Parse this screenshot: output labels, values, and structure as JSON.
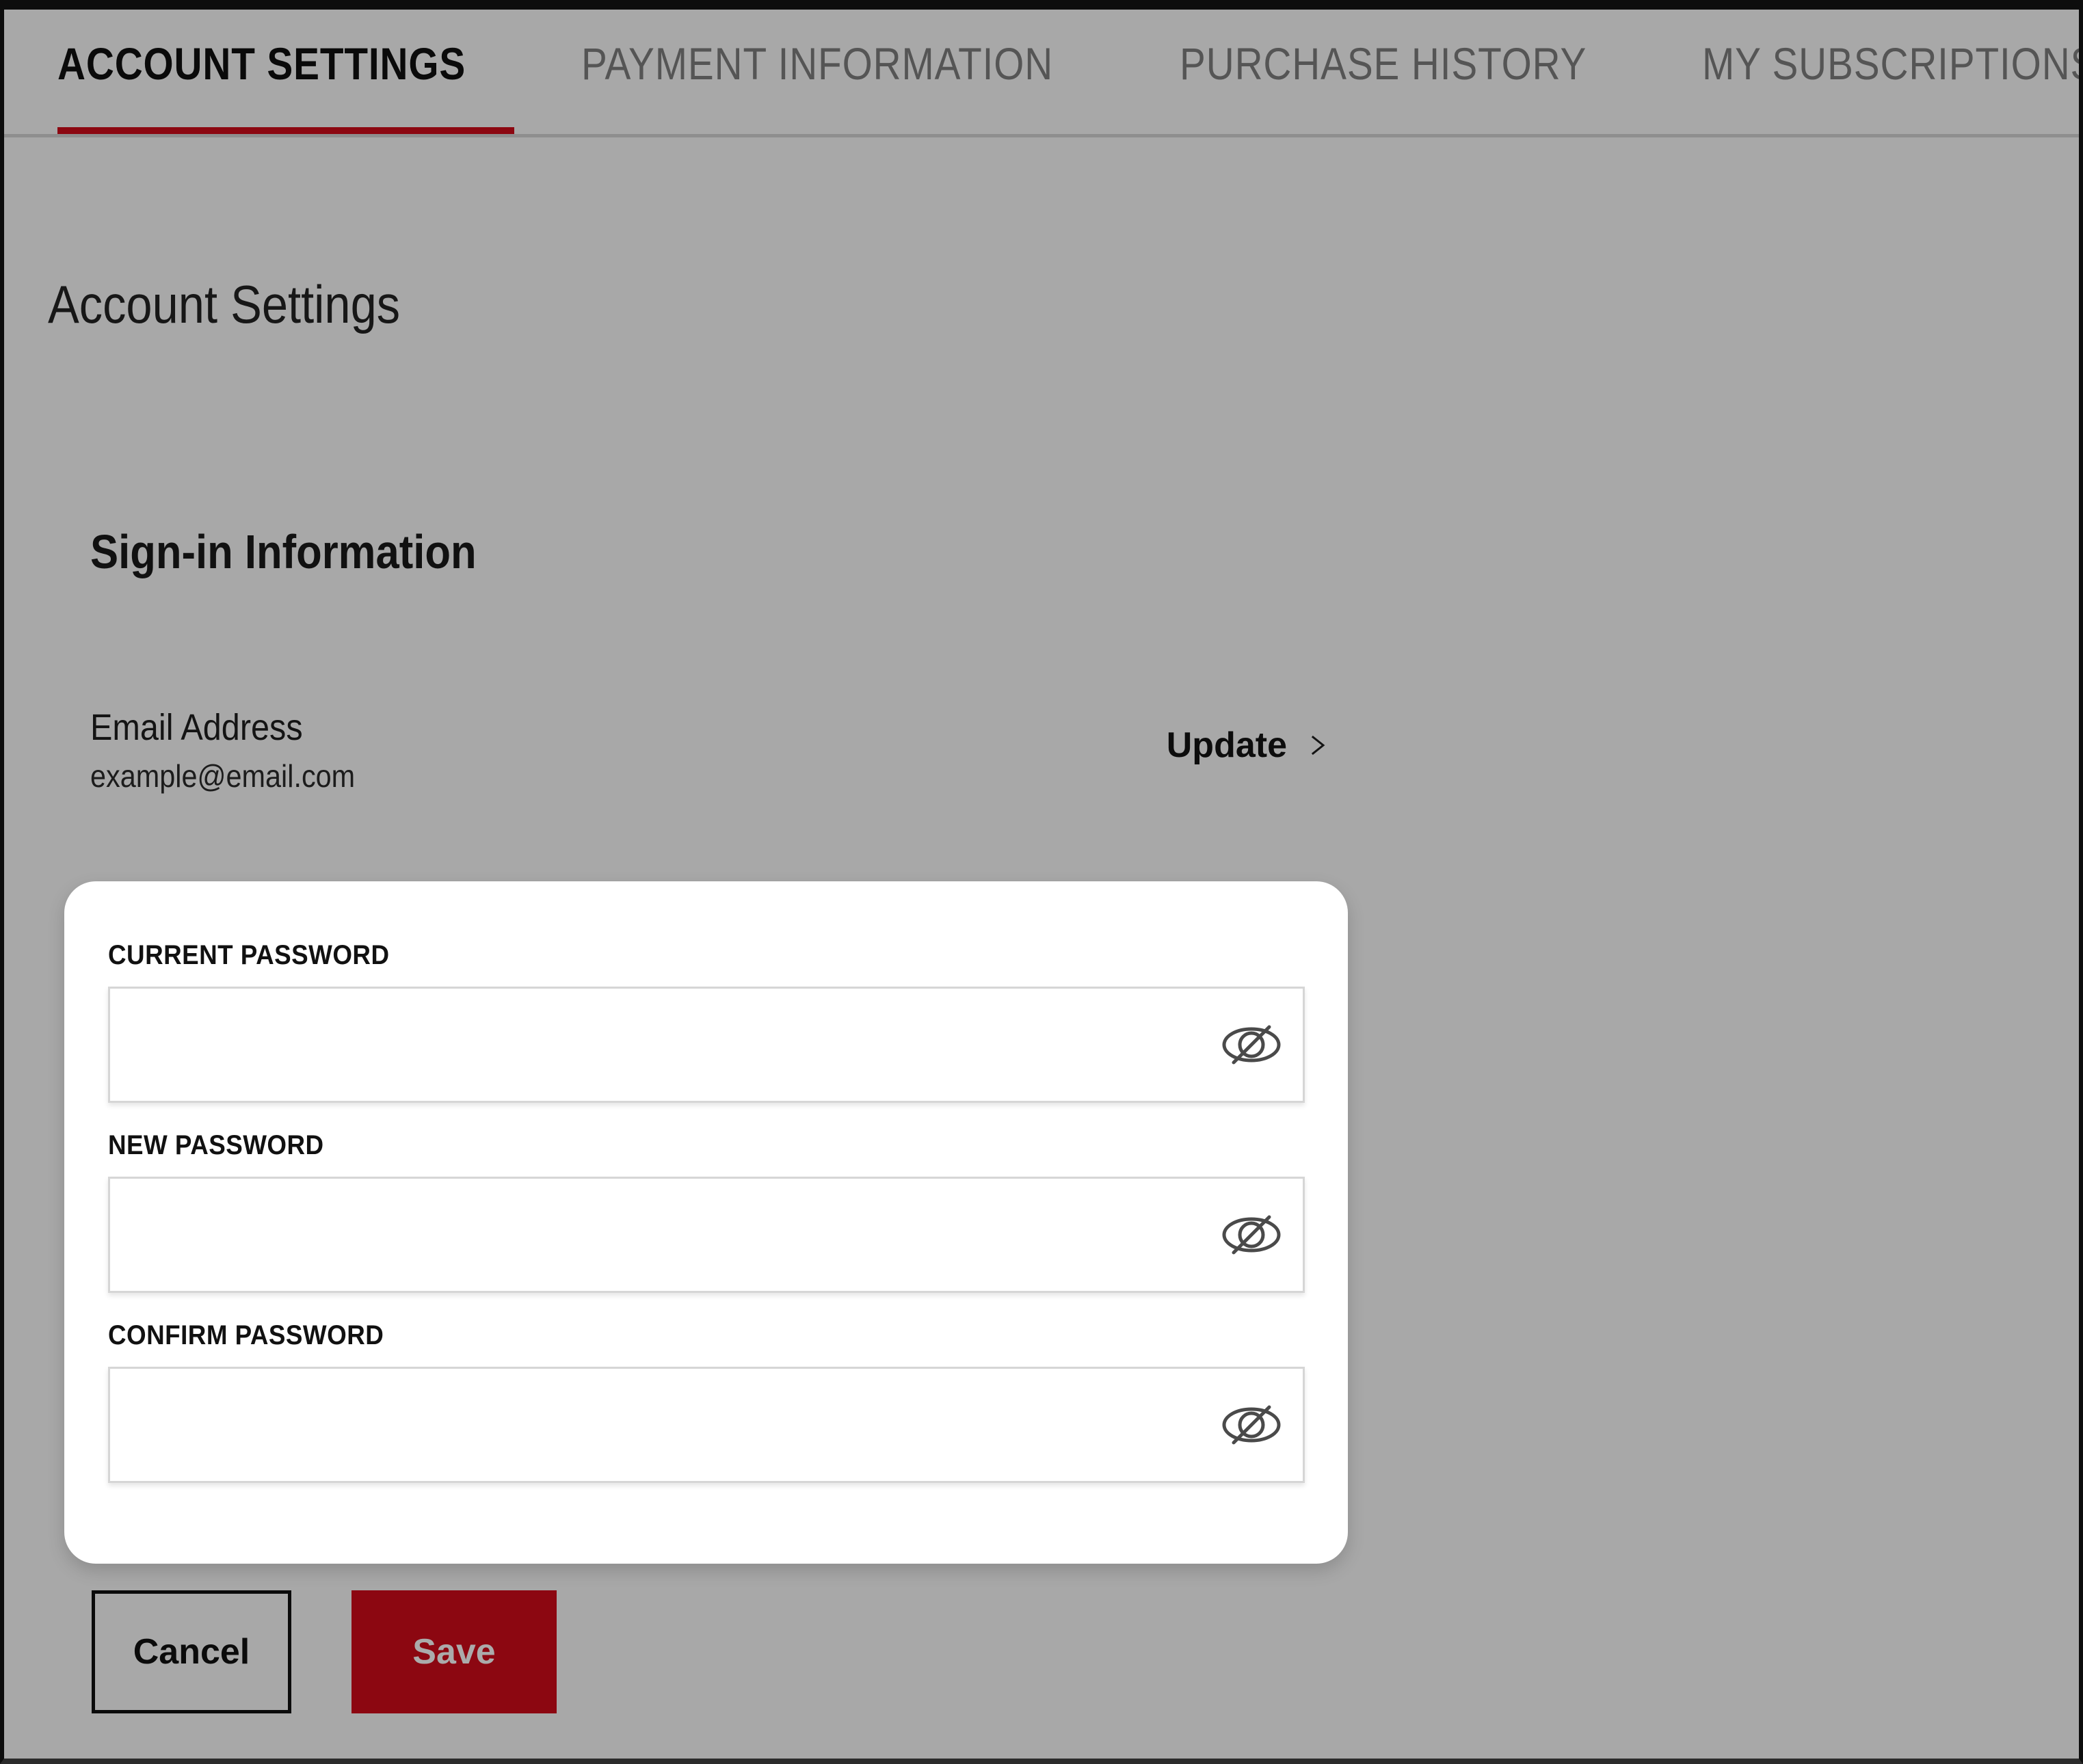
{
  "nav": {
    "tabs": [
      {
        "label": "ACCOUNT SETTINGS",
        "active": true
      },
      {
        "label": "PAYMENT INFORMATION",
        "active": false
      },
      {
        "label": "PURCHASE HISTORY",
        "active": false
      },
      {
        "label": "MY SUBSCRIPTIONS",
        "active": false
      }
    ],
    "active_indicator_color": "#8c0711"
  },
  "page": {
    "title": "Account Settings"
  },
  "section": {
    "title": "Sign-in Information",
    "email": {
      "label": "Email Address",
      "value": "example@email.com"
    },
    "update": {
      "label": "Update",
      "icon": "chevron-right-icon"
    }
  },
  "password_card": {
    "fields": [
      {
        "label": "CURRENT PASSWORD",
        "value": "",
        "placeholder": "",
        "toggle_icon": "eye-slash-icon"
      },
      {
        "label": "NEW PASSWORD",
        "value": "",
        "placeholder": "",
        "toggle_icon": "eye-slash-icon"
      },
      {
        "label": "CONFIRM PASSWORD",
        "value": "",
        "placeholder": "",
        "toggle_icon": "eye-slash-icon"
      }
    ]
  },
  "actions": {
    "cancel_label": "Cancel",
    "save_label": "Save",
    "save_bg_color": "#8c0711",
    "save_text_color": "#ababab"
  },
  "theme": {
    "page_background": "#a8a8a8",
    "accent": "#8c0711",
    "card_background": "#ffffff",
    "text_primary": "#111111",
    "text_muted": "#555555"
  }
}
